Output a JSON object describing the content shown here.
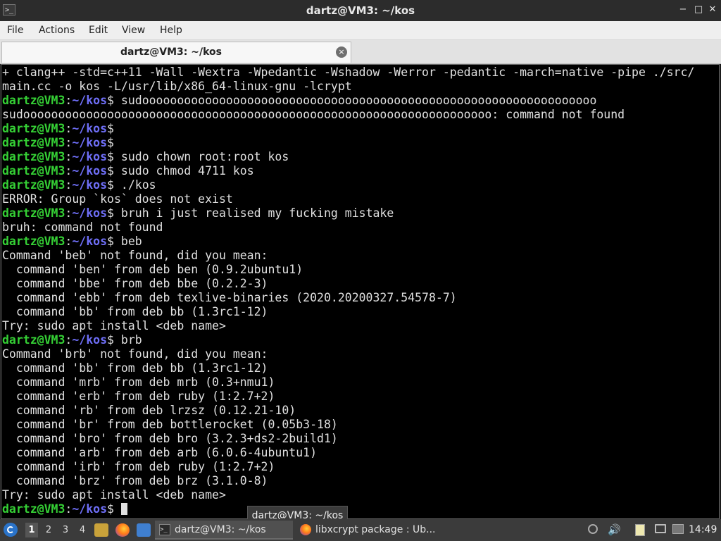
{
  "window": {
    "title": "dartz@VM3: ~/kos",
    "app_icon_glyph": ">_",
    "minimize_glyph": "−",
    "maximize_glyph": "□",
    "close_glyph": "✕"
  },
  "menu": [
    "File",
    "Actions",
    "Edit",
    "View",
    "Help"
  ],
  "tab": {
    "label": "dartz@VM3: ~/kos",
    "close_glyph": "×"
  },
  "prompt": {
    "user_host": "dartz@VM3",
    "sep": ":",
    "path": "~/kos",
    "symbol": "$"
  },
  "terminal_lines": [
    {
      "type": "out",
      "text": "+ clang++ -std=c++11 -Wall -Wextra -Wpedantic -Wshadow -Werror -pedantic -march=native -pipe ./src/"
    },
    {
      "type": "out",
      "text": "main.cc -o kos -L/usr/lib/x86_64-linux-gnu -lcrypt"
    },
    {
      "type": "prompt",
      "cmd": " sudooooooooooooooooooooooooooooooooooooooooooooooooooooooooooooooooo"
    },
    {
      "type": "out",
      "text": "sudooooooooooooooooooooooooooooooooooooooooooooooooooooooooooooooooooo: command not found"
    },
    {
      "type": "prompt",
      "cmd": ""
    },
    {
      "type": "prompt",
      "cmd": ""
    },
    {
      "type": "prompt",
      "cmd": " sudo chown root:root kos"
    },
    {
      "type": "prompt",
      "cmd": " sudo chmod 4711 kos"
    },
    {
      "type": "prompt",
      "cmd": " ./kos"
    },
    {
      "type": "out",
      "text": "ERROR: Group `kos` does not exist"
    },
    {
      "type": "prompt",
      "cmd": " bruh i just realised my fucking mistake"
    },
    {
      "type": "out",
      "text": "bruh: command not found"
    },
    {
      "type": "prompt",
      "cmd": " beb"
    },
    {
      "type": "out",
      "text": "Command 'beb' not found, did you mean:"
    },
    {
      "type": "out",
      "text": "  command 'ben' from deb ben (0.9.2ubuntu1)"
    },
    {
      "type": "out",
      "text": "  command 'bbe' from deb bbe (0.2.2-3)"
    },
    {
      "type": "out",
      "text": "  command 'ebb' from deb texlive-binaries (2020.20200327.54578-7)"
    },
    {
      "type": "out",
      "text": "  command 'bb' from deb bb (1.3rc1-12)"
    },
    {
      "type": "out",
      "text": "Try: sudo apt install <deb name>"
    },
    {
      "type": "prompt",
      "cmd": " brb"
    },
    {
      "type": "out",
      "text": "Command 'brb' not found, did you mean:"
    },
    {
      "type": "out",
      "text": "  command 'bb' from deb bb (1.3rc1-12)"
    },
    {
      "type": "out",
      "text": "  command 'mrb' from deb mrb (0.3+nmu1)"
    },
    {
      "type": "out",
      "text": "  command 'erb' from deb ruby (1:2.7+2)"
    },
    {
      "type": "out",
      "text": "  command 'rb' from deb lrzsz (0.12.21-10)"
    },
    {
      "type": "out",
      "text": "  command 'br' from deb bottlerocket (0.05b3-18)"
    },
    {
      "type": "out",
      "text": "  command 'bro' from deb bro (3.2.3+ds2-2build1)"
    },
    {
      "type": "out",
      "text": "  command 'arb' from deb arb (6.0.6-4ubuntu1)"
    },
    {
      "type": "out",
      "text": "  command 'irb' from deb ruby (1:2.7+2)"
    },
    {
      "type": "out",
      "text": "  command 'brz' from deb brz (3.1.0-8)"
    },
    {
      "type": "out",
      "text": "Try: sudo apt install <deb name>"
    },
    {
      "type": "prompt",
      "cmd": " ",
      "cursor": true
    }
  ],
  "tooltip": "dartz@VM3: ~/kos",
  "taskbar": {
    "workspaces": [
      "1",
      "2",
      "3",
      "4"
    ],
    "active_workspace": "1",
    "tasks": [
      {
        "label": "dartz@VM3: ~/kos",
        "icon": "terminal-icon",
        "active": true
      },
      {
        "label": "libxcrypt package : Ub...",
        "icon": "firefox-icon",
        "active": false
      }
    ],
    "clock": "14:49"
  },
  "colors": {
    "prompt_user": "#35d035",
    "prompt_path": "#6f6ff8",
    "terminal_bg": "#000000",
    "terminal_fg": "#e0e0e0"
  }
}
